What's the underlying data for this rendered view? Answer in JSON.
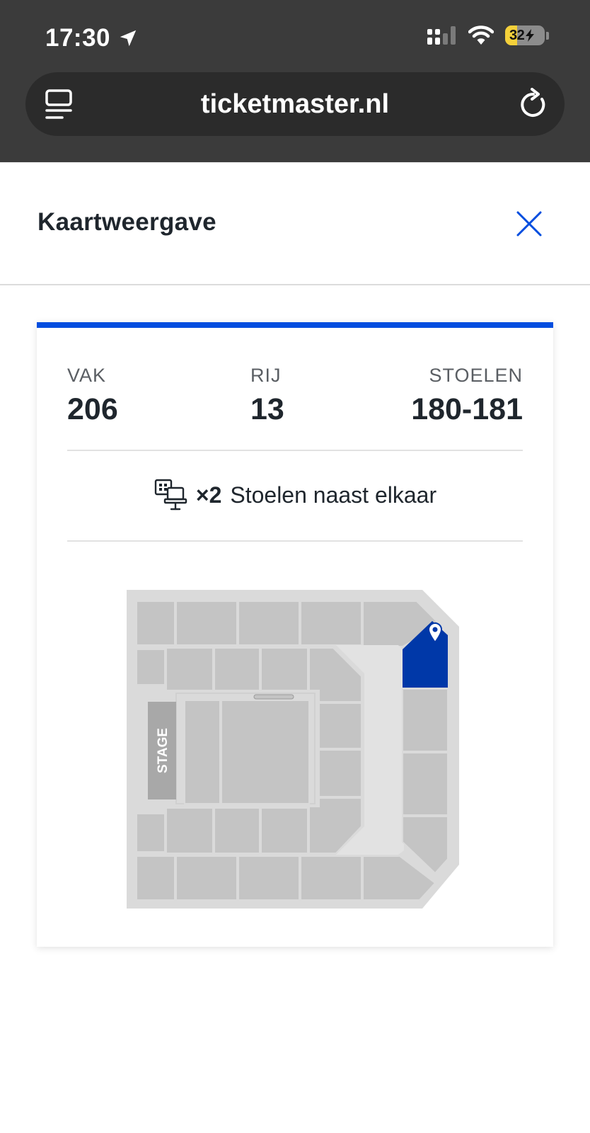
{
  "status_bar": {
    "time": "17:30",
    "battery_level": "32"
  },
  "browser": {
    "url": "ticketmaster.nl"
  },
  "sheet": {
    "title": "Kaartweergave"
  },
  "ticket": {
    "section_label": "VAK",
    "section_value": "206",
    "row_label": "RIJ",
    "row_value": "13",
    "seats_label": "STOELEN",
    "seats_value": "180-181",
    "seat_count": "×2",
    "seat_note": "Stoelen naast elkaar"
  },
  "map": {
    "stage_label": "STAGE",
    "highlight_color": "#0038a8",
    "section_color": "#c4c4c4",
    "aisle_color": "#dcdcdc"
  },
  "colors": {
    "accent": "#024ddf",
    "close_icon": "#024ddf"
  }
}
